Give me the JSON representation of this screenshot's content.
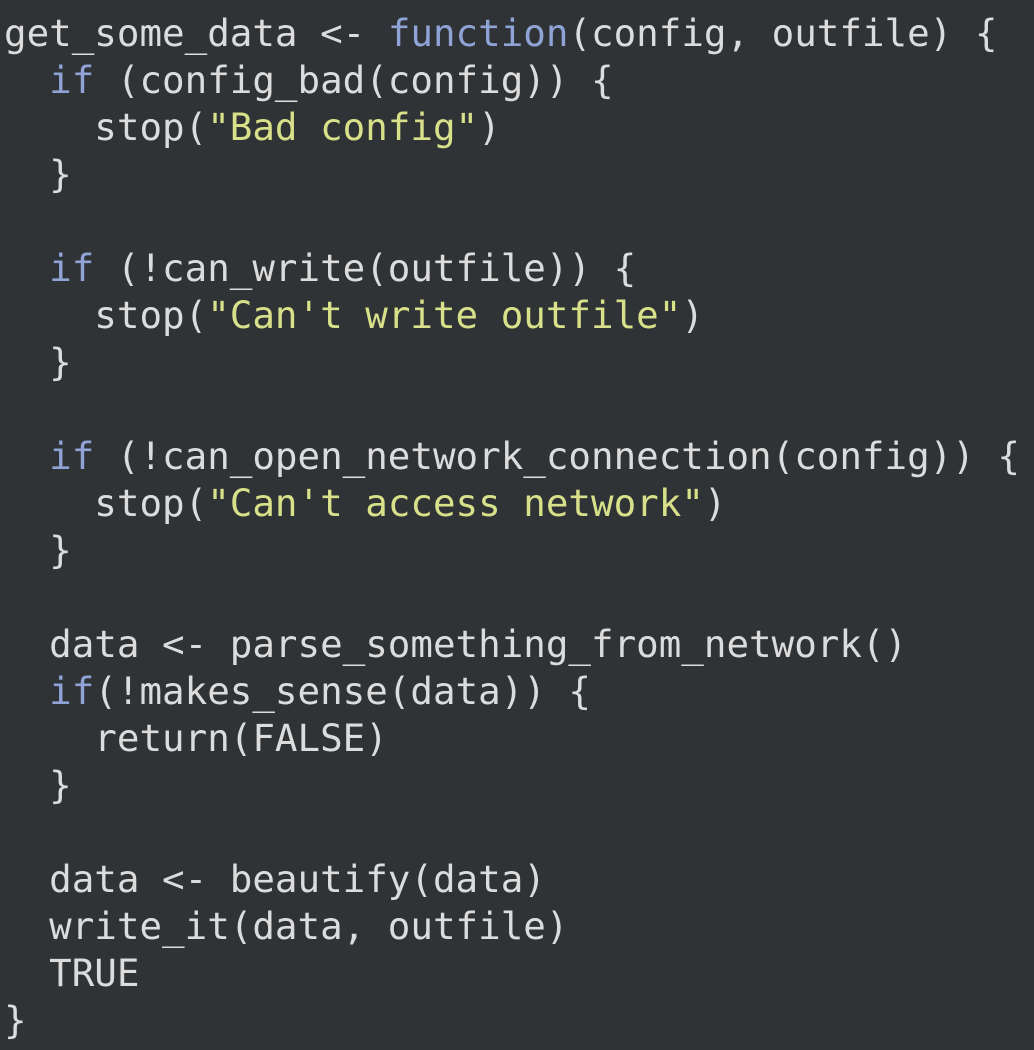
{
  "colors": {
    "background": "#303336",
    "default": "#dcdcdc",
    "keyword": "#8fa3d6",
    "string": "#d8e08a"
  },
  "code_lines": [
    [
      [
        "default",
        "get_some_data <- "
      ],
      [
        "keyword",
        "function"
      ],
      [
        "default",
        "(config, outfile) {"
      ]
    ],
    [
      [
        "default",
        "  "
      ],
      [
        "keyword",
        "if"
      ],
      [
        "default",
        " (config_bad(config)) {"
      ]
    ],
    [
      [
        "default",
        "    stop("
      ],
      [
        "string",
        "\"Bad config\""
      ],
      [
        "default",
        ")"
      ]
    ],
    [
      [
        "default",
        "  }"
      ]
    ],
    [],
    [
      [
        "default",
        "  "
      ],
      [
        "keyword",
        "if"
      ],
      [
        "default",
        " (!can_write(outfile)) {"
      ]
    ],
    [
      [
        "default",
        "    stop("
      ],
      [
        "string",
        "\"Can't write outfile\""
      ],
      [
        "default",
        ")"
      ]
    ],
    [
      [
        "default",
        "  }"
      ]
    ],
    [],
    [
      [
        "default",
        "  "
      ],
      [
        "keyword",
        "if"
      ],
      [
        "default",
        " (!can_open_network_connection(config)) {"
      ]
    ],
    [
      [
        "default",
        "    stop("
      ],
      [
        "string",
        "\"Can't access network\""
      ],
      [
        "default",
        ")"
      ]
    ],
    [
      [
        "default",
        "  }"
      ]
    ],
    [],
    [
      [
        "default",
        "  data <- parse_something_from_network()"
      ]
    ],
    [
      [
        "default",
        "  "
      ],
      [
        "keyword",
        "if"
      ],
      [
        "default",
        "(!makes_sense(data)) {"
      ]
    ],
    [
      [
        "default",
        "    return(FALSE)"
      ]
    ],
    [
      [
        "default",
        "  }"
      ]
    ],
    [],
    [
      [
        "default",
        "  data <- beautify(data)"
      ]
    ],
    [
      [
        "default",
        "  write_it(data, outfile)"
      ]
    ],
    [
      [
        "default",
        "  TRUE"
      ]
    ],
    [
      [
        "default",
        "}"
      ]
    ]
  ]
}
